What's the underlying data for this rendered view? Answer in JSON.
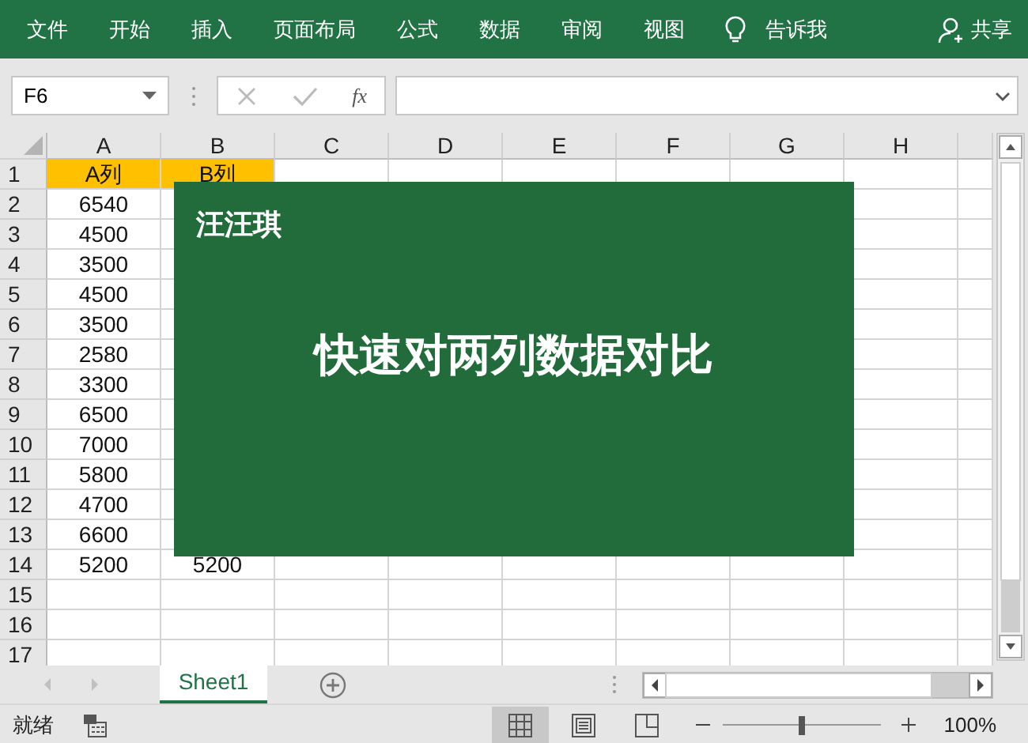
{
  "ribbon": {
    "tabs": [
      {
        "label": "文件"
      },
      {
        "label": "开始"
      },
      {
        "label": "插入"
      },
      {
        "label": "页面布局"
      },
      {
        "label": "公式"
      },
      {
        "label": "数据"
      },
      {
        "label": "审阅"
      },
      {
        "label": "视图"
      }
    ],
    "tell_me": "告诉我",
    "share": "共享"
  },
  "formula_bar": {
    "name_box": "F6",
    "function_button": "fx"
  },
  "sheet": {
    "columns": [
      "A",
      "B",
      "C",
      "D",
      "E",
      "F",
      "G",
      "H"
    ],
    "rows": [
      {
        "number": "1",
        "highlight": true,
        "cells": [
          "A列",
          "B列"
        ]
      },
      {
        "number": "2",
        "highlight": false,
        "cells": [
          "6540"
        ]
      },
      {
        "number": "3",
        "highlight": false,
        "cells": [
          "4500"
        ]
      },
      {
        "number": "4",
        "highlight": false,
        "cells": [
          "3500"
        ]
      },
      {
        "number": "5",
        "highlight": false,
        "cells": [
          "4500"
        ]
      },
      {
        "number": "6",
        "highlight": false,
        "cells": [
          "3500"
        ]
      },
      {
        "number": "7",
        "highlight": false,
        "cells": [
          "2580"
        ]
      },
      {
        "number": "8",
        "highlight": false,
        "cells": [
          "3300"
        ]
      },
      {
        "number": "9",
        "highlight": false,
        "cells": [
          "6500"
        ]
      },
      {
        "number": "10",
        "highlight": false,
        "cells": [
          "7000"
        ]
      },
      {
        "number": "11",
        "highlight": false,
        "cells": [
          "5800"
        ]
      },
      {
        "number": "12",
        "highlight": false,
        "cells": [
          "4700"
        ]
      },
      {
        "number": "13",
        "highlight": false,
        "cells": [
          "6600"
        ]
      },
      {
        "number": "14",
        "highlight": false,
        "cells": [
          "5200",
          "5200"
        ]
      },
      {
        "number": "15",
        "highlight": false,
        "cells": []
      },
      {
        "number": "16",
        "highlight": false,
        "cells": []
      },
      {
        "number": "17",
        "highlight": false,
        "cells": []
      }
    ],
    "banner": {
      "author": "汪汪琪",
      "title": "快速对两列数据对比"
    }
  },
  "sheet_tabs": [
    {
      "label": "Sheet1",
      "selected": true
    }
  ],
  "status_bar": {
    "status": "就绪",
    "views": [
      {
        "kind": "normal",
        "selected": true
      },
      {
        "kind": "page_layout",
        "selected": false
      },
      {
        "kind": "page_break",
        "selected": false
      }
    ],
    "zoom": {
      "level": 0.5,
      "reading": "100%"
    }
  }
}
